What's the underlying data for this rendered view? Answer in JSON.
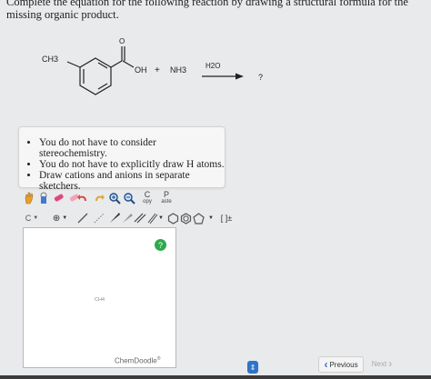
{
  "question": {
    "text": "Complete the equation for the following reaction by drawing a structural formula for the missing organic product."
  },
  "reaction": {
    "substituent_label": "CH3",
    "carbonyl_o_label": "O",
    "oh_label": "OH",
    "plus_sign": "+",
    "reagent": "NH3",
    "condition": "H2O",
    "product": "?"
  },
  "notes": {
    "items": [
      "You do not have to consider stereochemistry.",
      "You do not have to explicitly draw H atoms.",
      "Draw cations and anions in separate sketchers."
    ]
  },
  "toolbar": {
    "copy_top": "C",
    "copy_bottom": "opy",
    "paste_top": "P",
    "paste_bottom": "aste",
    "element_label": "C",
    "charge_label": "[ ]±"
  },
  "editor": {
    "canvas_hint": "CH4",
    "brand": "ChemDoodle",
    "brand_mark": "®",
    "help_symbol": "?"
  },
  "navigation": {
    "previous_label": "Previous",
    "next_label": "Next",
    "page_select_symbol": "⇕"
  },
  "colors": {
    "help_green": "#2fa84f",
    "nav_blue": "#2e74c9"
  }
}
